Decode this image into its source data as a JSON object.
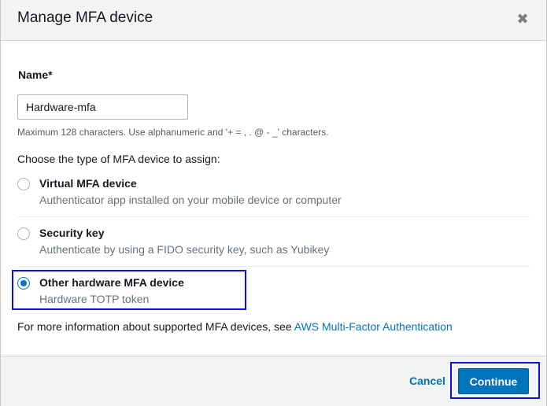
{
  "dialog": {
    "title": "Manage MFA device",
    "close_icon": "close-icon"
  },
  "name_field": {
    "label": "Name*",
    "value": "Hardware-mfa",
    "hint": "Maximum 128 characters. Use alphanumeric and '+ = , . @ - _' characters."
  },
  "device_type": {
    "prompt": "Choose the type of MFA device to assign:",
    "options": [
      {
        "title": "Virtual MFA device",
        "description": "Authenticator app installed on your mobile device or computer",
        "selected": false
      },
      {
        "title": "Security key",
        "description": "Authenticate by using a FIDO security key, such as Yubikey",
        "selected": false
      },
      {
        "title": "Other hardware MFA device",
        "description": "Hardware TOTP token",
        "selected": true
      }
    ]
  },
  "info": {
    "text": "For more information about supported MFA devices, see ",
    "link": "AWS Multi-Factor Authentication"
  },
  "footer": {
    "cancel_label": "Cancel",
    "continue_label": "Continue"
  },
  "colors": {
    "accent": "#0073bb",
    "highlight": "#1010d8"
  }
}
